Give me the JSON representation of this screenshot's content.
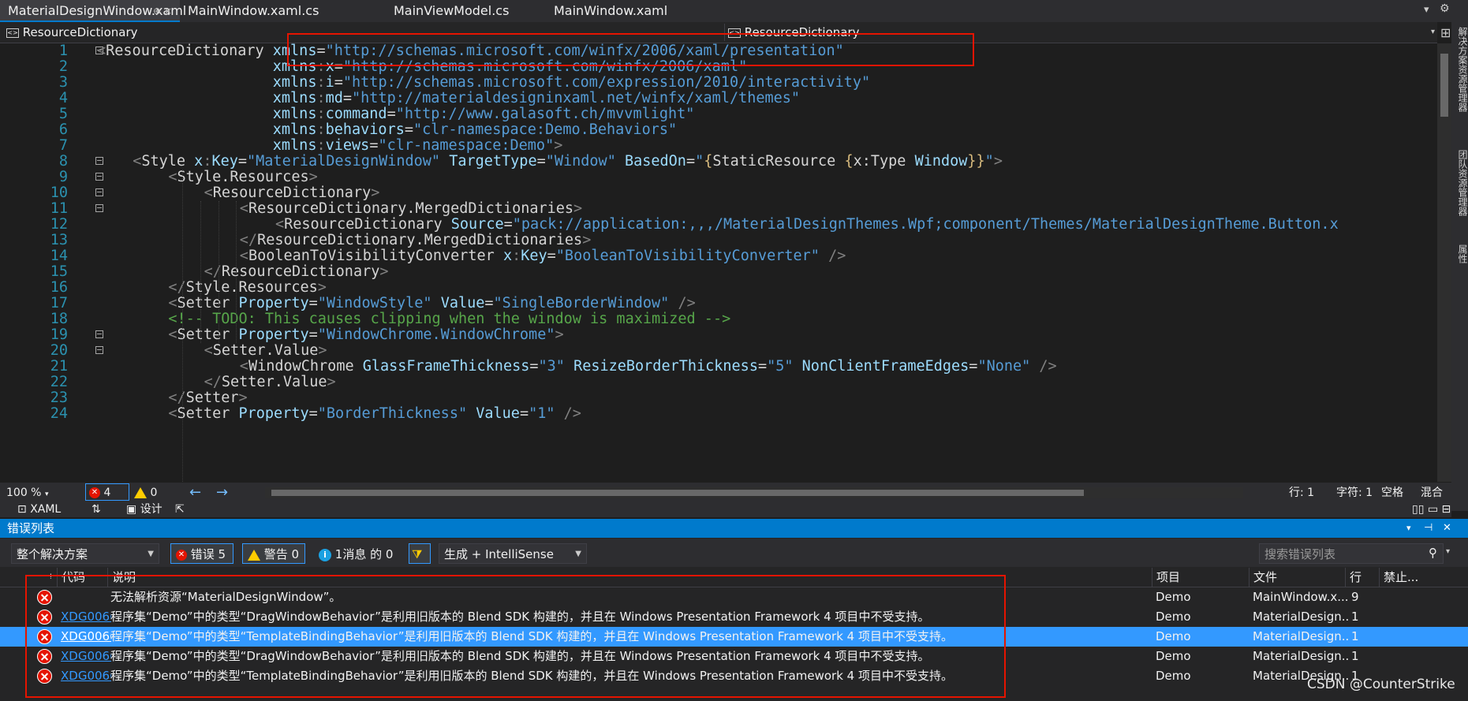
{
  "tabs": [
    {
      "label": "MaterialDesignWindow.xaml",
      "pin": "⊕ ×",
      "active": true
    },
    {
      "label": "MainWindow.xaml.cs",
      "active": false
    },
    {
      "label": "MainViewModel.cs",
      "active": false
    },
    {
      "label": "MainWindow.xaml",
      "active": false
    }
  ],
  "navbar": {
    "left": "ResourceDictionary",
    "right": "ResourceDictionary"
  },
  "code_lines": [
    {
      "n": "1",
      "indent": 0,
      "fold": true,
      "parts": [
        [
          "punct",
          "<"
        ],
        [
          "tag",
          "ResourceDictionary"
        ],
        [
          "sp",
          " "
        ],
        [
          "attr",
          "xmlns"
        ],
        [
          "eq",
          "="
        ],
        [
          "str",
          "\"http://schemas.microsoft.com/winfx/2006/xaml/presentation\""
        ]
      ]
    },
    {
      "n": "2",
      "indent": 0,
      "parts": [
        [
          "sp",
          "                    "
        ],
        [
          "attr",
          "xmlns"
        ],
        [
          "punct",
          ":"
        ],
        [
          "attr",
          "x"
        ],
        [
          "eq",
          "="
        ],
        [
          "str",
          "\"http://schemas.microsoft.com/winfx/2006/xaml\""
        ]
      ]
    },
    {
      "n": "3",
      "indent": 0,
      "parts": [
        [
          "sp",
          "                    "
        ],
        [
          "attr",
          "xmlns"
        ],
        [
          "punct",
          ":"
        ],
        [
          "attr",
          "i"
        ],
        [
          "eq",
          "="
        ],
        [
          "str",
          "\"http://schemas.microsoft.com/expression/2010/interactivity\""
        ]
      ]
    },
    {
      "n": "4",
      "indent": 0,
      "parts": [
        [
          "sp",
          "                    "
        ],
        [
          "attr",
          "xmlns"
        ],
        [
          "punct",
          ":"
        ],
        [
          "attr",
          "md"
        ],
        [
          "eq",
          "="
        ],
        [
          "str",
          "\"http://materialdesigninxaml.net/winfx/xaml/themes\""
        ]
      ]
    },
    {
      "n": "5",
      "indent": 0,
      "parts": [
        [
          "sp",
          "                    "
        ],
        [
          "attr",
          "xmlns"
        ],
        [
          "punct",
          ":"
        ],
        [
          "attr",
          "command"
        ],
        [
          "eq",
          "="
        ],
        [
          "str",
          "\"http://www.galasoft.ch/mvvmlight\""
        ]
      ]
    },
    {
      "n": "6",
      "indent": 0,
      "parts": [
        [
          "sp",
          "                    "
        ],
        [
          "attr",
          "xmlns"
        ],
        [
          "punct",
          ":"
        ],
        [
          "attr",
          "behaviors"
        ],
        [
          "eq",
          "="
        ],
        [
          "str",
          "\"clr-namespace:Demo.Behaviors\""
        ]
      ]
    },
    {
      "n": "7",
      "indent": 0,
      "parts": [
        [
          "sp",
          "                    "
        ],
        [
          "attr",
          "xmlns"
        ],
        [
          "punct",
          ":"
        ],
        [
          "attr",
          "views"
        ],
        [
          "eq",
          "="
        ],
        [
          "str",
          "\"clr-namespace:Demo\""
        ],
        [
          "punct",
          ">"
        ]
      ]
    },
    {
      "n": "8",
      "indent": 4,
      "fold": true,
      "parts": [
        [
          "punct",
          "<"
        ],
        [
          "tag",
          "Style"
        ],
        [
          "sp",
          " "
        ],
        [
          "attr",
          "x"
        ],
        [
          "punct",
          ":"
        ],
        [
          "attr",
          "Key"
        ],
        [
          "eq",
          "="
        ],
        [
          "str",
          "\"MaterialDesignWindow\""
        ],
        [
          "sp",
          " "
        ],
        [
          "attr",
          "TargetType"
        ],
        [
          "eq",
          "="
        ],
        [
          "str",
          "\"Window\""
        ],
        [
          "sp",
          " "
        ],
        [
          "attr",
          "BasedOn"
        ],
        [
          "eq",
          "="
        ],
        [
          "str",
          "\""
        ],
        [
          "markup",
          "{"
        ],
        [
          "tag",
          "StaticResource "
        ],
        [
          "markup",
          "{"
        ],
        [
          "tag",
          "x:Type "
        ],
        [
          "attr",
          "Window"
        ],
        [
          "markup",
          "}}"
        ],
        [
          "str",
          "\""
        ],
        [
          "punct",
          ">"
        ]
      ]
    },
    {
      "n": "9",
      "indent": 8,
      "fold": true,
      "parts": [
        [
          "punct",
          "<"
        ],
        [
          "tag",
          "Style.Resources"
        ],
        [
          "punct",
          ">"
        ]
      ]
    },
    {
      "n": "10",
      "indent": 12,
      "fold": true,
      "parts": [
        [
          "punct",
          "<"
        ],
        [
          "tag",
          "ResourceDictionary"
        ],
        [
          "punct",
          ">"
        ]
      ]
    },
    {
      "n": "11",
      "indent": 16,
      "fold": true,
      "parts": [
        [
          "punct",
          "<"
        ],
        [
          "tag",
          "ResourceDictionary.MergedDictionaries"
        ],
        [
          "punct",
          ">"
        ]
      ]
    },
    {
      "n": "12",
      "indent": 20,
      "parts": [
        [
          "punct",
          "<"
        ],
        [
          "tag",
          "ResourceDictionary"
        ],
        [
          "sp",
          " "
        ],
        [
          "attr",
          "Source"
        ],
        [
          "eq",
          "="
        ],
        [
          "str",
          "\"pack://application:,,,/MaterialDesignThemes.Wpf;component/Themes/MaterialDesignTheme.Button.x"
        ]
      ]
    },
    {
      "n": "13",
      "indent": 16,
      "parts": [
        [
          "punct",
          "</"
        ],
        [
          "tag",
          "ResourceDictionary.MergedDictionaries"
        ],
        [
          "punct",
          ">"
        ]
      ]
    },
    {
      "n": "14",
      "indent": 16,
      "parts": [
        [
          "punct",
          "<"
        ],
        [
          "tag",
          "BooleanToVisibilityConverter"
        ],
        [
          "sp",
          " "
        ],
        [
          "attr",
          "x"
        ],
        [
          "punct",
          ":"
        ],
        [
          "attr",
          "Key"
        ],
        [
          "eq",
          "="
        ],
        [
          "str",
          "\"BooleanToVisibilityConverter\""
        ],
        [
          "sp",
          " "
        ],
        [
          "punct",
          "/>"
        ]
      ]
    },
    {
      "n": "15",
      "indent": 12,
      "parts": [
        [
          "punct",
          "</"
        ],
        [
          "tag",
          "ResourceDictionary"
        ],
        [
          "punct",
          ">"
        ]
      ]
    },
    {
      "n": "16",
      "indent": 8,
      "parts": [
        [
          "punct",
          "</"
        ],
        [
          "tag",
          "Style.Resources"
        ],
        [
          "punct",
          ">"
        ]
      ]
    },
    {
      "n": "17",
      "indent": 8,
      "parts": [
        [
          "punct",
          "<"
        ],
        [
          "tag",
          "Setter"
        ],
        [
          "sp",
          " "
        ],
        [
          "attr",
          "Property"
        ],
        [
          "eq",
          "="
        ],
        [
          "str",
          "\"WindowStyle\""
        ],
        [
          "sp",
          " "
        ],
        [
          "attr",
          "Value"
        ],
        [
          "eq",
          "="
        ],
        [
          "str",
          "\"SingleBorderWindow\""
        ],
        [
          "sp",
          " "
        ],
        [
          "punct",
          "/>"
        ]
      ]
    },
    {
      "n": "18",
      "indent": 8,
      "parts": [
        [
          "cmt",
          "<!-- TODO: This causes clipping when the window is maximized -->"
        ]
      ]
    },
    {
      "n": "19",
      "indent": 8,
      "fold": true,
      "parts": [
        [
          "punct",
          "<"
        ],
        [
          "tag",
          "Setter"
        ],
        [
          "sp",
          " "
        ],
        [
          "attr",
          "Property"
        ],
        [
          "eq",
          "="
        ],
        [
          "str",
          "\"WindowChrome.WindowChrome\""
        ],
        [
          "punct",
          ">"
        ]
      ]
    },
    {
      "n": "20",
      "indent": 12,
      "fold": true,
      "parts": [
        [
          "punct",
          "<"
        ],
        [
          "tag",
          "Setter.Value"
        ],
        [
          "punct",
          ">"
        ]
      ]
    },
    {
      "n": "21",
      "indent": 16,
      "parts": [
        [
          "punct",
          "<"
        ],
        [
          "tag",
          "WindowChrome"
        ],
        [
          "sp",
          " "
        ],
        [
          "attr",
          "GlassFrameThickness"
        ],
        [
          "eq",
          "="
        ],
        [
          "str",
          "\"3\""
        ],
        [
          "sp",
          " "
        ],
        [
          "attr",
          "ResizeBorderThickness"
        ],
        [
          "eq",
          "="
        ],
        [
          "str",
          "\"5\""
        ],
        [
          "sp",
          " "
        ],
        [
          "attr",
          "NonClientFrameEdges"
        ],
        [
          "eq",
          "="
        ],
        [
          "str",
          "\"None\""
        ],
        [
          "sp",
          " "
        ],
        [
          "punct",
          "/>"
        ]
      ]
    },
    {
      "n": "22",
      "indent": 12,
      "parts": [
        [
          "punct",
          "</"
        ],
        [
          "tag",
          "Setter.Value"
        ],
        [
          "punct",
          ">"
        ]
      ]
    },
    {
      "n": "23",
      "indent": 8,
      "parts": [
        [
          "punct",
          "</"
        ],
        [
          "tag",
          "Setter"
        ],
        [
          "punct",
          ">"
        ]
      ]
    },
    {
      "n": "24",
      "indent": 8,
      "parts": [
        [
          "punct",
          "<"
        ],
        [
          "tag",
          "Setter"
        ],
        [
          "sp",
          " "
        ],
        [
          "attr",
          "Property"
        ],
        [
          "eq",
          "="
        ],
        [
          "str",
          "\"BorderThickness\""
        ],
        [
          "sp",
          " "
        ],
        [
          "attr",
          "Value"
        ],
        [
          "eq",
          "="
        ],
        [
          "str",
          "\"1\""
        ],
        [
          "sp",
          " "
        ],
        [
          "punct",
          "/>"
        ]
      ]
    }
  ],
  "status": {
    "zoom": "100 %",
    "errors": "4",
    "warnings": "0",
    "line": "行: 1",
    "char": "字符: 1",
    "space": "空格",
    "mixed": "混合"
  },
  "design": {
    "xaml": "XAML",
    "swap": "⇅",
    "design": "设计"
  },
  "side_labels": [
    "解决方案资源管理器",
    "团队资源管理器",
    "属性"
  ],
  "errorlist": {
    "title": "错误列表",
    "scope": "整个解决方案",
    "errors_btn": "错误 5",
    "warnings_btn": "警告 0",
    "messages_btn": "1消息 的 0",
    "source": "生成 + IntelliSense",
    "search_placeholder": "搜索错误列表",
    "columns": {
      "code": "代码",
      "desc": "说明",
      "project": "项目",
      "file": "文件",
      "line": "行",
      "suppress": "禁止..."
    },
    "rows": [
      {
        "code": "",
        "desc": "无法解析资源“MaterialDesignWindow”。",
        "project": "Demo",
        "file": "MainWindow.x...",
        "line": "9",
        "selected": false
      },
      {
        "code": "XDG0066",
        "desc": "程序集“Demo”中的类型“DragWindowBehavior”是利用旧版本的 Blend SDK 构建的，并且在 Windows Presentation Framework 4 项目中不受支持。",
        "project": "Demo",
        "file": "MaterialDesign...",
        "line": "1",
        "selected": false
      },
      {
        "code": "XDG0066",
        "desc": "程序集“Demo”中的类型“TemplateBindingBehavior”是利用旧版本的 Blend SDK 构建的，并且在 Windows Presentation Framework 4 项目中不受支持。",
        "project": "Demo",
        "file": "MaterialDesign...",
        "line": "1",
        "selected": true
      },
      {
        "code": "XDG0066",
        "desc": "程序集“Demo”中的类型“DragWindowBehavior”是利用旧版本的 Blend SDK 构建的，并且在 Windows Presentation Framework 4 项目中不受支持。",
        "project": "Demo",
        "file": "MaterialDesign...",
        "line": "1",
        "selected": false
      },
      {
        "code": "XDG0066",
        "desc": "程序集“Demo”中的类型“TemplateBindingBehavior”是利用旧版本的 Blend SDK 构建的，并且在 Windows Presentation Framework 4 项目中不受支持。",
        "project": "Demo",
        "file": "MaterialDesign...",
        "line": "1",
        "selected": false
      }
    ]
  },
  "watermark": "CSDN @CounterStrike",
  "colors": {
    "accent": "#007acc",
    "selection": "#3399ff",
    "error": "#e51400",
    "highlight_box": "#e51400"
  }
}
